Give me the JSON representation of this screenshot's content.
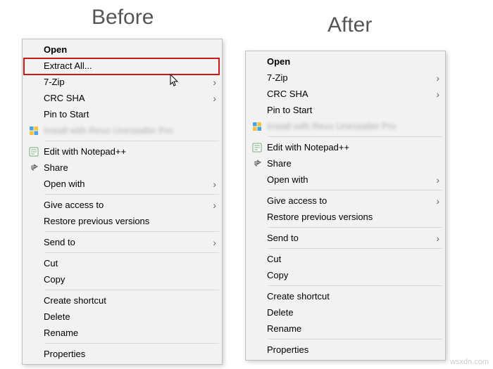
{
  "headings": {
    "before": "Before",
    "after": "After"
  },
  "watermark": "wsxdn.com",
  "before": [
    {
      "label": "Open"
    },
    {
      "label": "Extract All..."
    },
    {
      "label": "7-Zip",
      "sub": true
    },
    {
      "label": "CRC SHA",
      "sub": true
    },
    {
      "label": "Pin to Start"
    },
    {
      "label": "Install with Revo Uninstaller Pro"
    },
    {
      "label": "Edit with Notepad++"
    },
    {
      "label": "Share"
    },
    {
      "label": "Open with",
      "sub": true
    },
    {
      "label": "Give access to",
      "sub": true
    },
    {
      "label": "Restore previous versions"
    },
    {
      "label": "Send to",
      "sub": true
    },
    {
      "label": "Cut"
    },
    {
      "label": "Copy"
    },
    {
      "label": "Create shortcut"
    },
    {
      "label": "Delete"
    },
    {
      "label": "Rename"
    },
    {
      "label": "Properties"
    }
  ],
  "after": [
    {
      "label": "Open"
    },
    {
      "label": "7-Zip",
      "sub": true
    },
    {
      "label": "CRC SHA",
      "sub": true
    },
    {
      "label": "Pin to Start"
    },
    {
      "label": "Install with Revo Uninstaller Pro"
    },
    {
      "label": "Edit with Notepad++"
    },
    {
      "label": "Share"
    },
    {
      "label": "Open with",
      "sub": true
    },
    {
      "label": "Give access to",
      "sub": true
    },
    {
      "label": "Restore previous versions"
    },
    {
      "label": "Send to",
      "sub": true
    },
    {
      "label": "Cut"
    },
    {
      "label": "Copy"
    },
    {
      "label": "Create shortcut"
    },
    {
      "label": "Delete"
    },
    {
      "label": "Rename"
    },
    {
      "label": "Properties"
    }
  ]
}
